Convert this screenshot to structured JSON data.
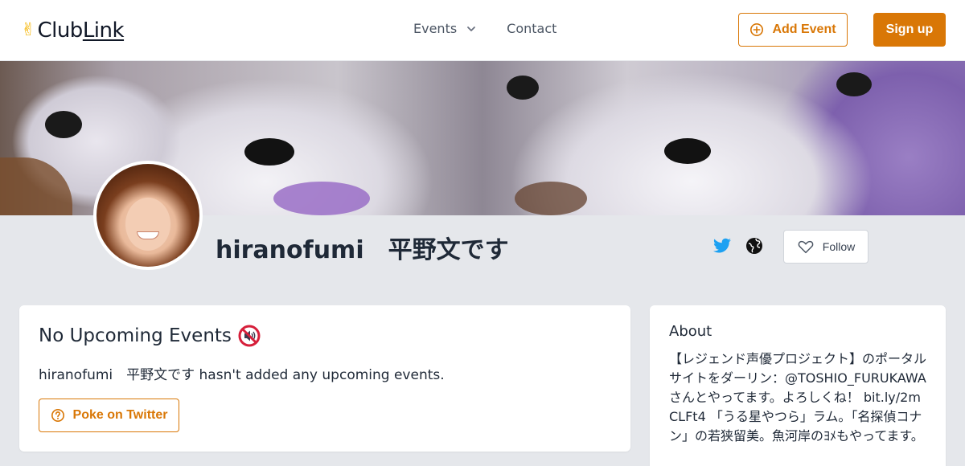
{
  "header": {
    "logo_prefix": "Club",
    "logo_link": "Link",
    "nav": [
      {
        "label": "Events",
        "has_dropdown": true
      },
      {
        "label": "Contact",
        "has_dropdown": false
      }
    ],
    "add_event_label": "Add Event",
    "signup_label": "Sign up"
  },
  "profile": {
    "name": "hiranofumi　平野文です",
    "follow_label": "Follow",
    "social": [
      "twitter-icon",
      "globe-icon"
    ]
  },
  "events_card": {
    "title": "No Upcoming Events",
    "message": "hiranofumi　平野文です hasn't added any upcoming events.",
    "poke_label": "Poke on Twitter"
  },
  "about_card": {
    "title": "About",
    "text": "【レジェンド声優プロジェクト】のポータルサイトをダーリン：@TOSHIO_FURUKAWAさんとやってます。よろしくね！ bit.ly/2mCLFt4 「うる星やつら」ラム。「名探偵コナン」の若狭留美。魚河岸のﾖﾒもやってます。"
  },
  "colors": {
    "accent": "#d97706",
    "twitter": "#1da1f2",
    "background": "#e5e7eb"
  }
}
